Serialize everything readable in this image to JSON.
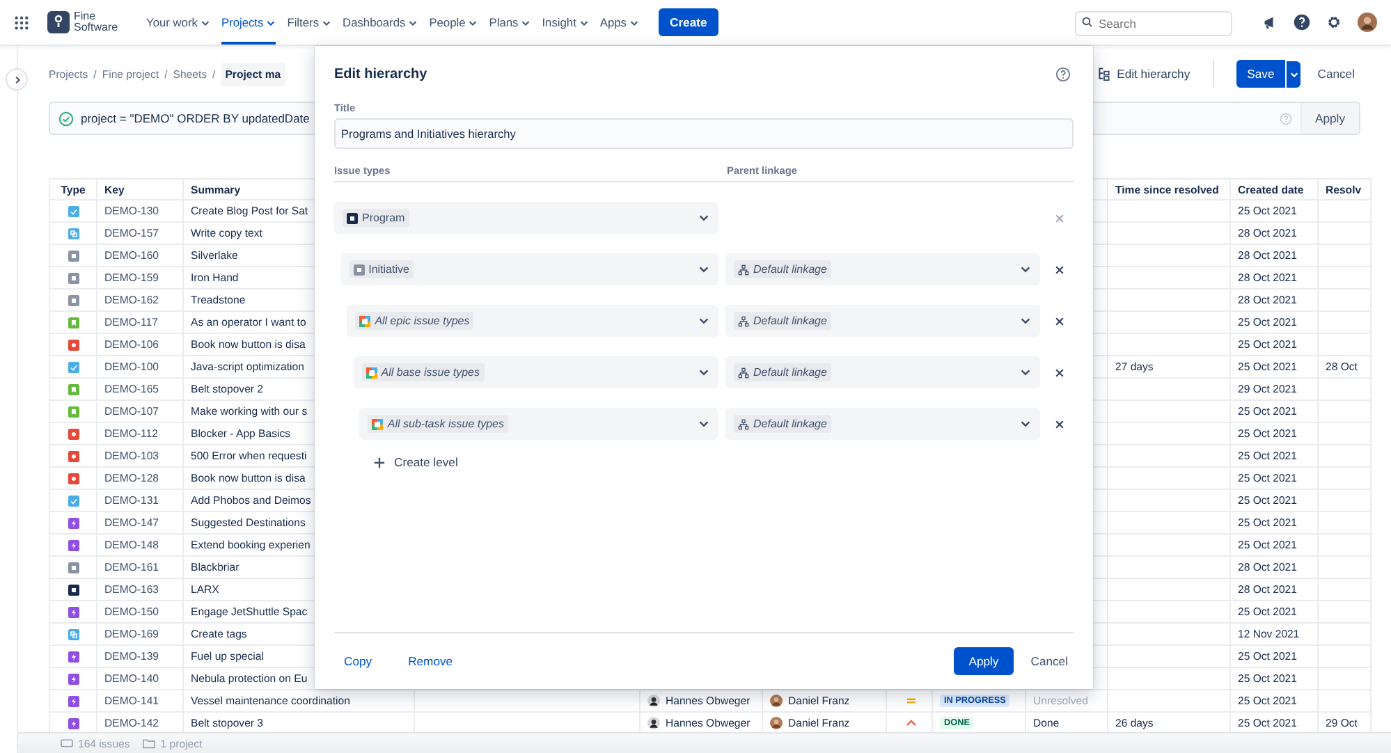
{
  "nav": {
    "brand": "Fine Software",
    "items": [
      {
        "label": "Your work",
        "selected": false
      },
      {
        "label": "Projects",
        "selected": true
      },
      {
        "label": "Filters",
        "selected": false
      },
      {
        "label": "Dashboards",
        "selected": false
      },
      {
        "label": "People",
        "selected": false
      },
      {
        "label": "Plans",
        "selected": false
      },
      {
        "label": "Insight",
        "selected": false
      },
      {
        "label": "Apps",
        "selected": false
      }
    ],
    "create": "Create",
    "search_placeholder": "Search"
  },
  "breadcrumbs": {
    "items": [
      "Projects",
      "Fine project",
      "Sheets"
    ],
    "separator": "/"
  },
  "sheet_name": "Project ma",
  "toolbar": {
    "edit_hierarchy": "Edit hierarchy",
    "save": "Save",
    "cancel": "Cancel"
  },
  "query": {
    "text": "project = \"DEMO\" ORDER BY updatedDate",
    "valid": true,
    "apply": "Apply"
  },
  "table": {
    "columns": {
      "type": "Type",
      "key": "Key",
      "summary": "Summary",
      "time_since_resolved": "Time since resolved",
      "created": "Created date",
      "resolved": "Resolv"
    },
    "rows": [
      {
        "kind": "task",
        "key": "DEMO-130",
        "summary": "Create Blog Post for Sat",
        "created": "25 Oct 2021"
      },
      {
        "kind": "subtask",
        "key": "DEMO-157",
        "summary": "Write copy text",
        "created": "28 Oct 2021"
      },
      {
        "kind": "initiative",
        "key": "DEMO-160",
        "summary": "Silverlake",
        "created": "28 Oct 2021"
      },
      {
        "kind": "initiative",
        "key": "DEMO-159",
        "summary": "Iron Hand",
        "created": "28 Oct 2021"
      },
      {
        "kind": "initiative",
        "key": "DEMO-162",
        "summary": "Treadstone",
        "created": "28 Oct 2021"
      },
      {
        "kind": "story",
        "key": "DEMO-117",
        "summary": "As an operator I want to",
        "created": "25 Oct 2021"
      },
      {
        "kind": "bug",
        "key": "DEMO-106",
        "summary": "Book now button is disa",
        "created": "25 Oct 2021"
      },
      {
        "kind": "task",
        "key": "DEMO-100",
        "summary": "Java-script optimization",
        "time_since_resolved": "27 days",
        "created": "25 Oct 2021",
        "resolved": "28 Oct"
      },
      {
        "kind": "story",
        "key": "DEMO-165",
        "summary": "Belt stopover 2",
        "created": "29 Oct 2021"
      },
      {
        "kind": "story",
        "key": "DEMO-107",
        "summary": "Make working with our s",
        "created": "25 Oct 2021"
      },
      {
        "kind": "bug",
        "key": "DEMO-112",
        "summary": "Blocker - App Basics",
        "created": "25 Oct 2021"
      },
      {
        "kind": "bug",
        "key": "DEMO-103",
        "summary": "500 Error when requesti",
        "created": "25 Oct 2021"
      },
      {
        "kind": "bug",
        "key": "DEMO-128",
        "summary": "Book now button is disa",
        "created": "25 Oct 2021"
      },
      {
        "kind": "task",
        "key": "DEMO-131",
        "summary": "Add Phobos and Deimos",
        "created": "25 Oct 2021"
      },
      {
        "kind": "epic",
        "key": "DEMO-147",
        "summary": "Suggested Destinations",
        "created": "25 Oct 2021"
      },
      {
        "kind": "epic",
        "key": "DEMO-148",
        "summary": "Extend booking experien",
        "created": "25 Oct 2021"
      },
      {
        "kind": "initiative",
        "key": "DEMO-161",
        "summary": "Blackbriar",
        "created": "28 Oct 2021"
      },
      {
        "kind": "program",
        "key": "DEMO-163",
        "summary": "LARX",
        "created": "28 Oct 2021"
      },
      {
        "kind": "epic",
        "key": "DEMO-150",
        "summary": "Engage JetShuttle Spac",
        "created": "25 Oct 2021"
      },
      {
        "kind": "subtask",
        "key": "DEMO-169",
        "summary": "Create tags",
        "created": "12 Nov 2021"
      },
      {
        "kind": "epic",
        "key": "DEMO-139",
        "summary": "Fuel up special",
        "created": "25 Oct 2021"
      },
      {
        "kind": "epic",
        "key": "DEMO-140",
        "summary": "Nebula protection on Eu",
        "created": "25 Oct 2021"
      },
      {
        "kind": "epic",
        "key": "DEMO-141",
        "summary": "Vessel maintenance coordination",
        "assignee": "Hannes Obweger",
        "reporter": "Daniel Franz",
        "priority": {
          "kind": "medium"
        },
        "status": {
          "label": "IN PROGRESS",
          "kind": "in_progress"
        },
        "resolution": {
          "label": "Unresolved",
          "resolved": false
        },
        "created": "25 Oct 2021"
      },
      {
        "kind": "epic",
        "key": "DEMO-142",
        "summary": "Belt stopover 3",
        "assignee": "Hannes Obweger",
        "reporter": "Daniel Franz",
        "priority": {
          "kind": "high"
        },
        "status": {
          "label": "DONE",
          "kind": "done"
        },
        "resolution": {
          "label": "Done",
          "resolved": true
        },
        "time_since_resolved": "26 days",
        "created": "25 Oct 2021",
        "resolved": "29 Oct"
      }
    ]
  },
  "status_bar": {
    "issues": "164 issues",
    "projects": "1 project"
  },
  "dialog": {
    "title": "Edit hierarchy",
    "title_label": "Title",
    "title_value": "Programs and Initiatives hierarchy",
    "issue_types_header": "Issue types",
    "parent_linkage_header": "Parent linkage",
    "levels": [
      {
        "issue_type": {
          "label": "Program",
          "kind": "program",
          "generic": false
        },
        "removable": false,
        "children": [
          {
            "issue_type": {
              "label": "Initiative",
              "kind": "initiative",
              "generic": false
            },
            "linkage": "Default linkage",
            "removable": true,
            "children": [
              {
                "issue_type": {
                  "label": "All epic issue types",
                  "kind": "all",
                  "generic": true
                },
                "linkage": "Default linkage",
                "removable": true,
                "children": [
                  {
                    "issue_type": {
                      "label": "All base issue types",
                      "kind": "all",
                      "generic": true
                    },
                    "linkage": "Default linkage",
                    "removable": true,
                    "children": [
                      {
                        "issue_type": {
                          "label": "All sub-task issue types",
                          "kind": "all",
                          "generic": true
                        },
                        "linkage": "Default linkage",
                        "removable": true
                      }
                    ]
                  }
                ]
              }
            ]
          }
        ]
      }
    ],
    "create_level": "Create level",
    "actions": [
      "Copy",
      "Remove"
    ],
    "apply": "Apply",
    "cancel": "Cancel"
  }
}
